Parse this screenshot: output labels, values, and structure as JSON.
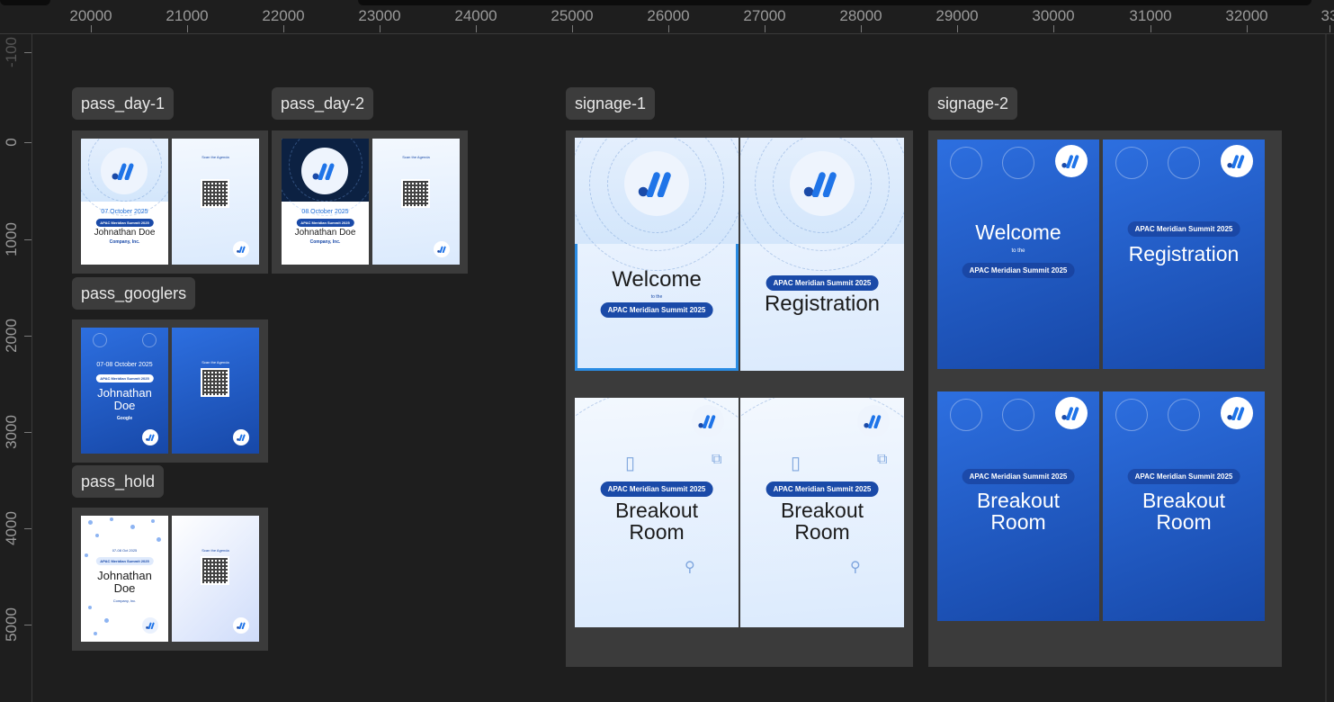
{
  "ruler": {
    "horizontal": [
      "20000",
      "21000",
      "22000",
      "23000",
      "24000",
      "25000",
      "26000",
      "27000",
      "28000",
      "29000",
      "30000",
      "31000",
      "32000",
      "33"
    ],
    "vertical": [
      "-100",
      "0",
      "1000",
      "2000",
      "3000",
      "4000",
      "5000"
    ]
  },
  "frames": {
    "pass_day_1": "pass_day-1",
    "pass_day_2": "pass_day-2",
    "pass_googlers": "pass_googlers",
    "pass_hold": "pass_hold",
    "signage_1": "signage-1",
    "signage_2": "signage-2"
  },
  "pass_day_1": {
    "date": "07 October 2025",
    "event": "APAC Meridian Summit 2025",
    "name": "Johnathan Doe",
    "company": "Company, Inc.",
    "back_header": "Scan the Agenda"
  },
  "pass_day_2": {
    "date": "08 October 2025",
    "event": "APAC Meridian Summit 2025",
    "name": "Johnathan Doe",
    "company": "Company, Inc.",
    "back_header": "Scan the Agenda"
  },
  "pass_googlers": {
    "date": "07-08 October 2025",
    "event": "APAC Meridian Summit 2025",
    "name_line1": "Johnathan",
    "name_line2": "Doe",
    "company": "Google",
    "back_header": "Scan the Agenda"
  },
  "pass_hold": {
    "date": "07-08 Oct 2025",
    "event": "APAC Meridian Summit 2025",
    "name_line1": "Johnathan",
    "name_line2": "Doe",
    "company": "Company, Inc.",
    "back_header": "Scan the Agenda"
  },
  "signage_1": {
    "welcome": "Welcome",
    "to_the": "to the",
    "event": "APAC Meridian Summit 2025",
    "registration": "Registration",
    "breakout_line1": "Breakout",
    "breakout_line2": "Room"
  },
  "signage_2": {
    "welcome": "Welcome",
    "to_the": "to the",
    "event": "APAC Meridian Summit 2025",
    "registration": "Registration",
    "breakout_line1": "Breakout",
    "breakout_line2": "Room"
  },
  "colors": {
    "canvas": "#1e1e1e",
    "frame": "#3b3b3b",
    "label_bg": "#3c3c3c",
    "brand_blue": "#1a4aa8",
    "selection": "#2a8ce4"
  }
}
